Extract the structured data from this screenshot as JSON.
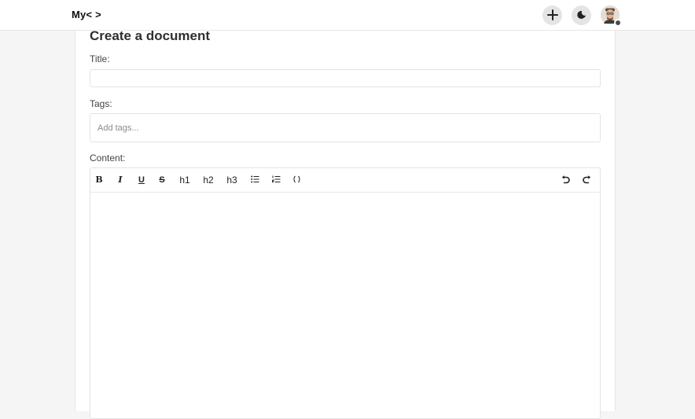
{
  "header": {
    "logo": "My< >",
    "icons": [
      "plus-icon",
      "moon-icon",
      "user-avatar"
    ]
  },
  "form": {
    "heading": "Create a document",
    "title_label": "Title:",
    "title_value": "",
    "tags_label": "Tags:",
    "tags_placeholder": "Add tags...",
    "content_label": "Content:"
  },
  "toolbar": {
    "bold": "B",
    "italic": "I",
    "underline": "U",
    "strike": "S",
    "h1": "h1",
    "h2": "h2",
    "h3": "h3",
    "icons": [
      "bullet-list-icon",
      "ordered-list-icon",
      "code-icon",
      "undo-icon",
      "redo-icon"
    ]
  },
  "colors": {
    "background": "#f5f5f5",
    "surface": "#ffffff",
    "border": "#e3e3e3",
    "icon_button": "#e4e4e4"
  }
}
